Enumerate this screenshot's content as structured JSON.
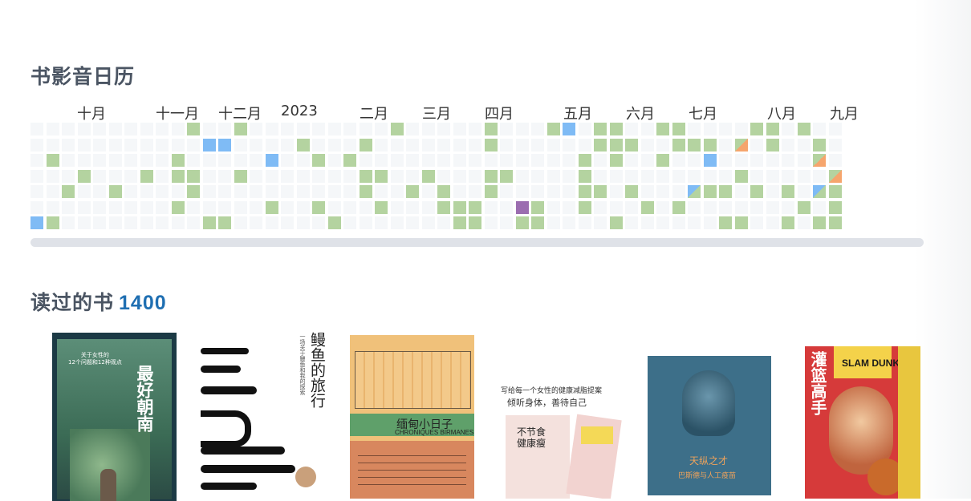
{
  "calendar": {
    "title": "书影音日历",
    "months": [
      "十月",
      "十一月",
      "十二月",
      "2023",
      "二月",
      "三月",
      "四月",
      "五月",
      "六月",
      "七月",
      "八月",
      "九月"
    ],
    "colors": {
      "empty": "#f5f7f9",
      "book": "#b4d3a0",
      "movie": "#7fbbf5",
      "music": "#9b6db0",
      "game": "#f6a56d"
    }
  },
  "books": {
    "title": "读过的书",
    "count": "1400",
    "items": [
      {
        "title": "最好朝南",
        "subtitle": "关于女性的\n12个问题和12种观点"
      },
      {
        "title": "鳗鱼的旅行",
        "subtitle": "一场关于鳗鱼和我的探索"
      },
      {
        "title": "缅甸小日子",
        "subtitle": "CHRONIQUES BIRMANES"
      },
      {
        "title": "不节食健康瘦",
        "subtitle": "倾听身体，善待自己",
        "tagline": "写给每一个女性的健康减脂提案"
      },
      {
        "title": "天纵之才",
        "subtitle": "巴斯德与人工疫苗"
      },
      {
        "title": "灌篮高手",
        "subtitle": "SLAM DUNK"
      }
    ]
  }
}
